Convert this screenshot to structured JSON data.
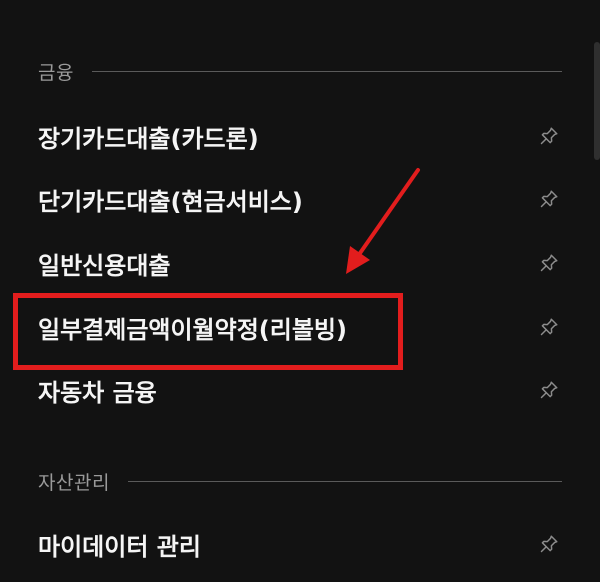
{
  "sections": [
    {
      "title": "금융",
      "items": [
        {
          "label": "장기카드대출(카드론)",
          "icon": "pin-icon"
        },
        {
          "label": "단기카드대출(현금서비스)",
          "icon": "pin-icon"
        },
        {
          "label": "일반신용대출",
          "icon": "pin-icon"
        },
        {
          "label": "일부결제금액이월약정(리볼빙)",
          "icon": "pin-icon"
        },
        {
          "label": "자동차 금융",
          "icon": "pin-icon"
        }
      ]
    },
    {
      "title": "자산관리",
      "items": [
        {
          "label": "마이데이터 관리",
          "icon": "pin-icon"
        }
      ]
    }
  ],
  "annotation": {
    "color": "#e21d1d"
  }
}
